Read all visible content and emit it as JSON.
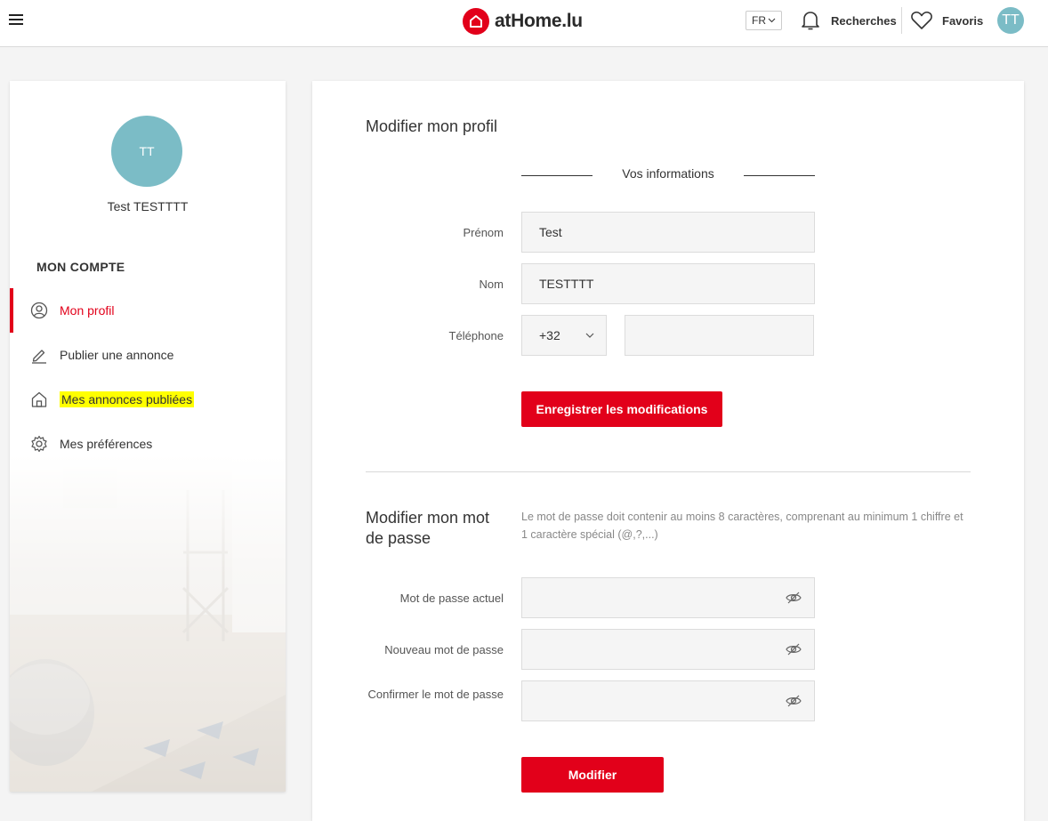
{
  "header": {
    "logo_text": "atHome.lu",
    "lang": "FR",
    "recherches": "Recherches",
    "favoris": "Favoris",
    "avatar_initials": "TT"
  },
  "sidebar": {
    "avatar_initials": "TT",
    "user_name": "Test TESTTTT",
    "section_title": "MON COMPTE",
    "items": [
      {
        "label": "Mon profil",
        "icon": "user-circle-icon",
        "active": true
      },
      {
        "label": "Publier une annonce",
        "icon": "pencil-icon",
        "active": false
      },
      {
        "label": "Mes annonces publiées",
        "icon": "house-icon",
        "active": false,
        "highlighted": true
      },
      {
        "label": "Mes préférences",
        "icon": "gear-icon",
        "active": false
      }
    ]
  },
  "profile": {
    "title": "Modifier mon profil",
    "section": "Vos informations",
    "prenom_label": "Prénom",
    "prenom_value": "Test",
    "nom_label": "Nom",
    "nom_value": "TESTTTT",
    "tel_label": "Téléphone",
    "tel_prefix": "+32",
    "tel_value": "",
    "save_button": "Enregistrer les modifications"
  },
  "password": {
    "title": "Modifier mon mot de passe",
    "hint": "Le mot de passe doit contenir au moins 8 caractères, comprenant au minimum 1 chiffre et 1 caractère spécial (@,?,...)",
    "current_label": "Mot de passe actuel",
    "new_label": "Nouveau mot de passe",
    "confirm_label": "Confirmer le mot de passe",
    "submit_button": "Modifier"
  },
  "colors": {
    "brand_red": "#e2001a",
    "avatar_teal": "#7bbcc6",
    "highlight": "#ffff00"
  }
}
